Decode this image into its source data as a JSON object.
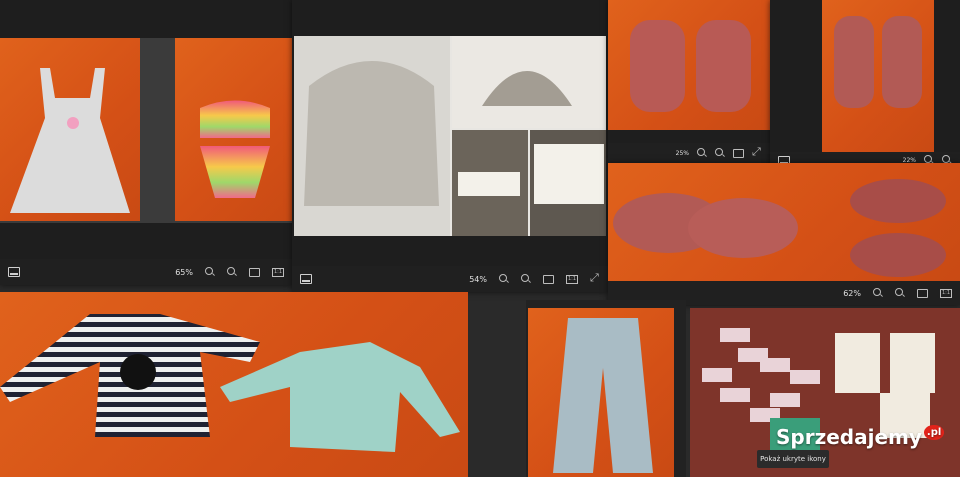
{
  "viewers": {
    "dress_window": {
      "zoom": "65%"
    },
    "hat_window": {
      "zoom": "54%"
    },
    "sandals_small_window": {
      "zoom": "25%"
    },
    "sandals_right_window": {
      "zoom": "22%"
    },
    "sandals_bottom_window": {
      "zoom": "62%"
    }
  },
  "taskbar": {
    "show_hidden_icons": "Pokaż ukryte ikony"
  },
  "watermark": {
    "brand": "Sprzedajemy",
    "tld": ".pl"
  },
  "colors": {
    "toolbar_bg": "#202020",
    "photo_bg_orange": "#d45016"
  }
}
